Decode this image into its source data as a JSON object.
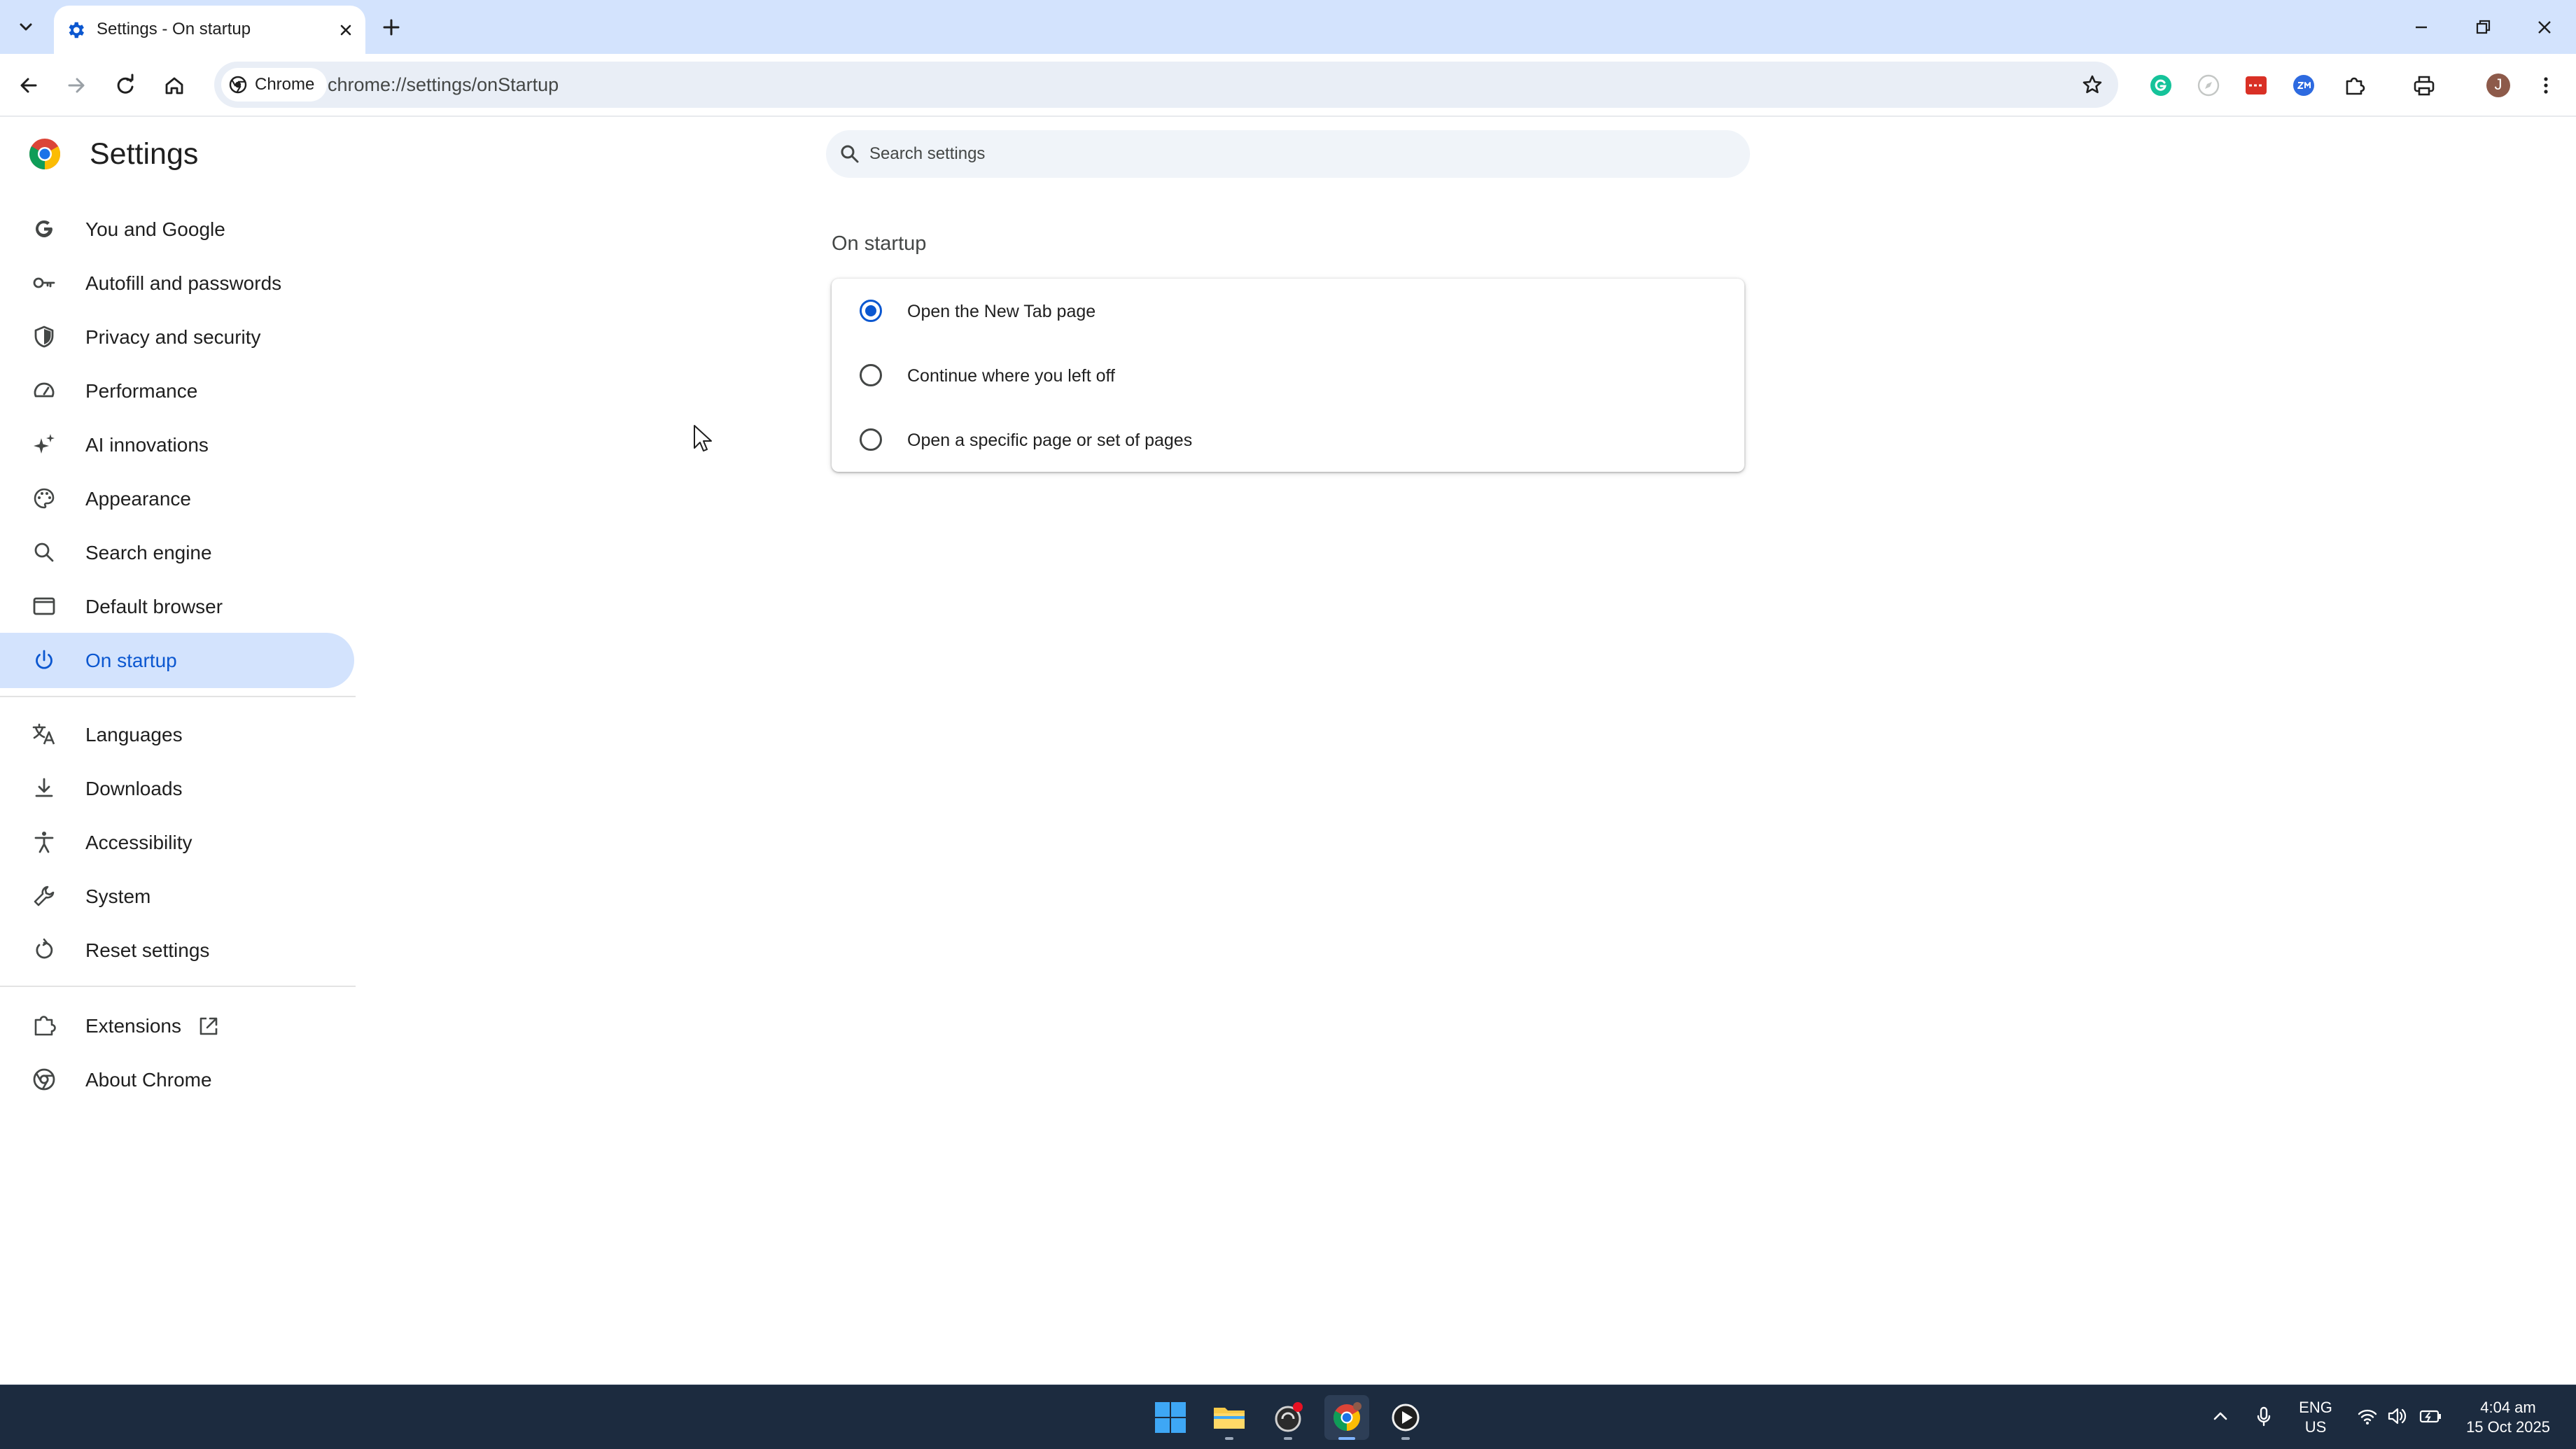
{
  "browser": {
    "tab": {
      "title": "Settings - On startup"
    },
    "omnibox": {
      "chip_label": "Chrome",
      "url": "chrome://settings/onStartup"
    },
    "profile_initial": "J"
  },
  "settings": {
    "title": "Settings",
    "search": {
      "placeholder": "Search settings"
    },
    "nav": {
      "main": [
        {
          "label": "You and Google",
          "icon": "google-g-icon",
          "active": false
        },
        {
          "label": "Autofill and passwords",
          "icon": "key-icon",
          "active": false
        },
        {
          "label": "Privacy and security",
          "icon": "shield-icon",
          "active": false
        },
        {
          "label": "Performance",
          "icon": "speedometer-icon",
          "active": false
        },
        {
          "label": "AI innovations",
          "icon": "sparkle-icon",
          "active": false
        },
        {
          "label": "Appearance",
          "icon": "palette-icon",
          "active": false
        },
        {
          "label": "Search engine",
          "icon": "search-icon",
          "active": false
        },
        {
          "label": "Default browser",
          "icon": "browser-window-icon",
          "active": false
        },
        {
          "label": "On startup",
          "icon": "power-icon",
          "active": true
        }
      ],
      "secondary": [
        {
          "label": "Languages",
          "icon": "translate-icon"
        },
        {
          "label": "Downloads",
          "icon": "download-icon"
        },
        {
          "label": "Accessibility",
          "icon": "accessibility-icon"
        },
        {
          "label": "System",
          "icon": "wrench-icon"
        },
        {
          "label": "Reset settings",
          "icon": "reset-icon"
        }
      ],
      "footer": [
        {
          "label": "Extensions",
          "icon": "puzzle-icon"
        },
        {
          "label": "About Chrome",
          "icon": "chrome-icon"
        }
      ]
    },
    "on_startup": {
      "title": "On startup",
      "options": [
        {
          "label": "Open the New Tab page",
          "selected": true
        },
        {
          "label": "Continue where you left off",
          "selected": false
        },
        {
          "label": "Open a specific page or set of pages",
          "selected": false
        }
      ]
    }
  },
  "taskbar": {
    "language": {
      "line1": "ENG",
      "line2": "US"
    },
    "clock": {
      "time": "4:04 am",
      "date": "15 Oct 2025"
    }
  },
  "colors": {
    "accent": "#0b57d0",
    "active_nav_bg": "#d3e3fd",
    "tab_strip_bg": "#d3e3fd",
    "taskbar_bg": "#1c2b3f"
  }
}
